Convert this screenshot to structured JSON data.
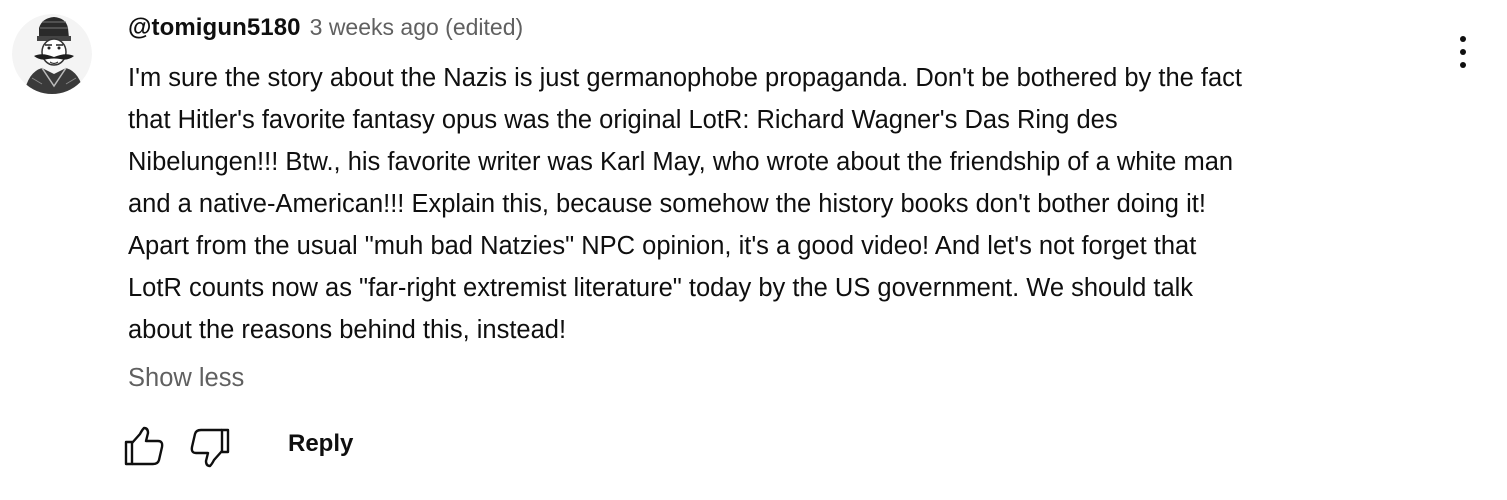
{
  "comment": {
    "author": "@tomigun5180",
    "timestamp": "3 weeks ago (edited)",
    "lines": [
      "I'm sure the story about the Nazis is just germanophobe propaganda. Don't be bothered by the fact",
      "that Hitler's favorite fantasy opus was the original LotR: Richard Wagner's Das Ring des",
      "Nibelungen!!! Btw., his favorite writer was Karl May, who wrote about the friendship of a white man",
      "and a native-American!!! Explain this, because somehow the history books don't bother doing it!",
      "Apart from the usual \"muh bad Natzies\" NPC opinion, it's a good video! And let's not forget that",
      "LotR counts now as \"far-right extremist literature\" today by the US government. We should talk",
      "about the reasons behind this, instead!"
    ],
    "show_less_label": "Show less",
    "reply_label": "Reply"
  },
  "icons": {
    "avatar": "avatar-portrait-icon",
    "menu": "more-vert-icon",
    "like": "thumbs-up-icon",
    "dislike": "thumbs-down-icon"
  },
  "colors": {
    "primary_text": "#0f0f0f",
    "secondary_text": "#606060",
    "background": "#ffffff"
  }
}
